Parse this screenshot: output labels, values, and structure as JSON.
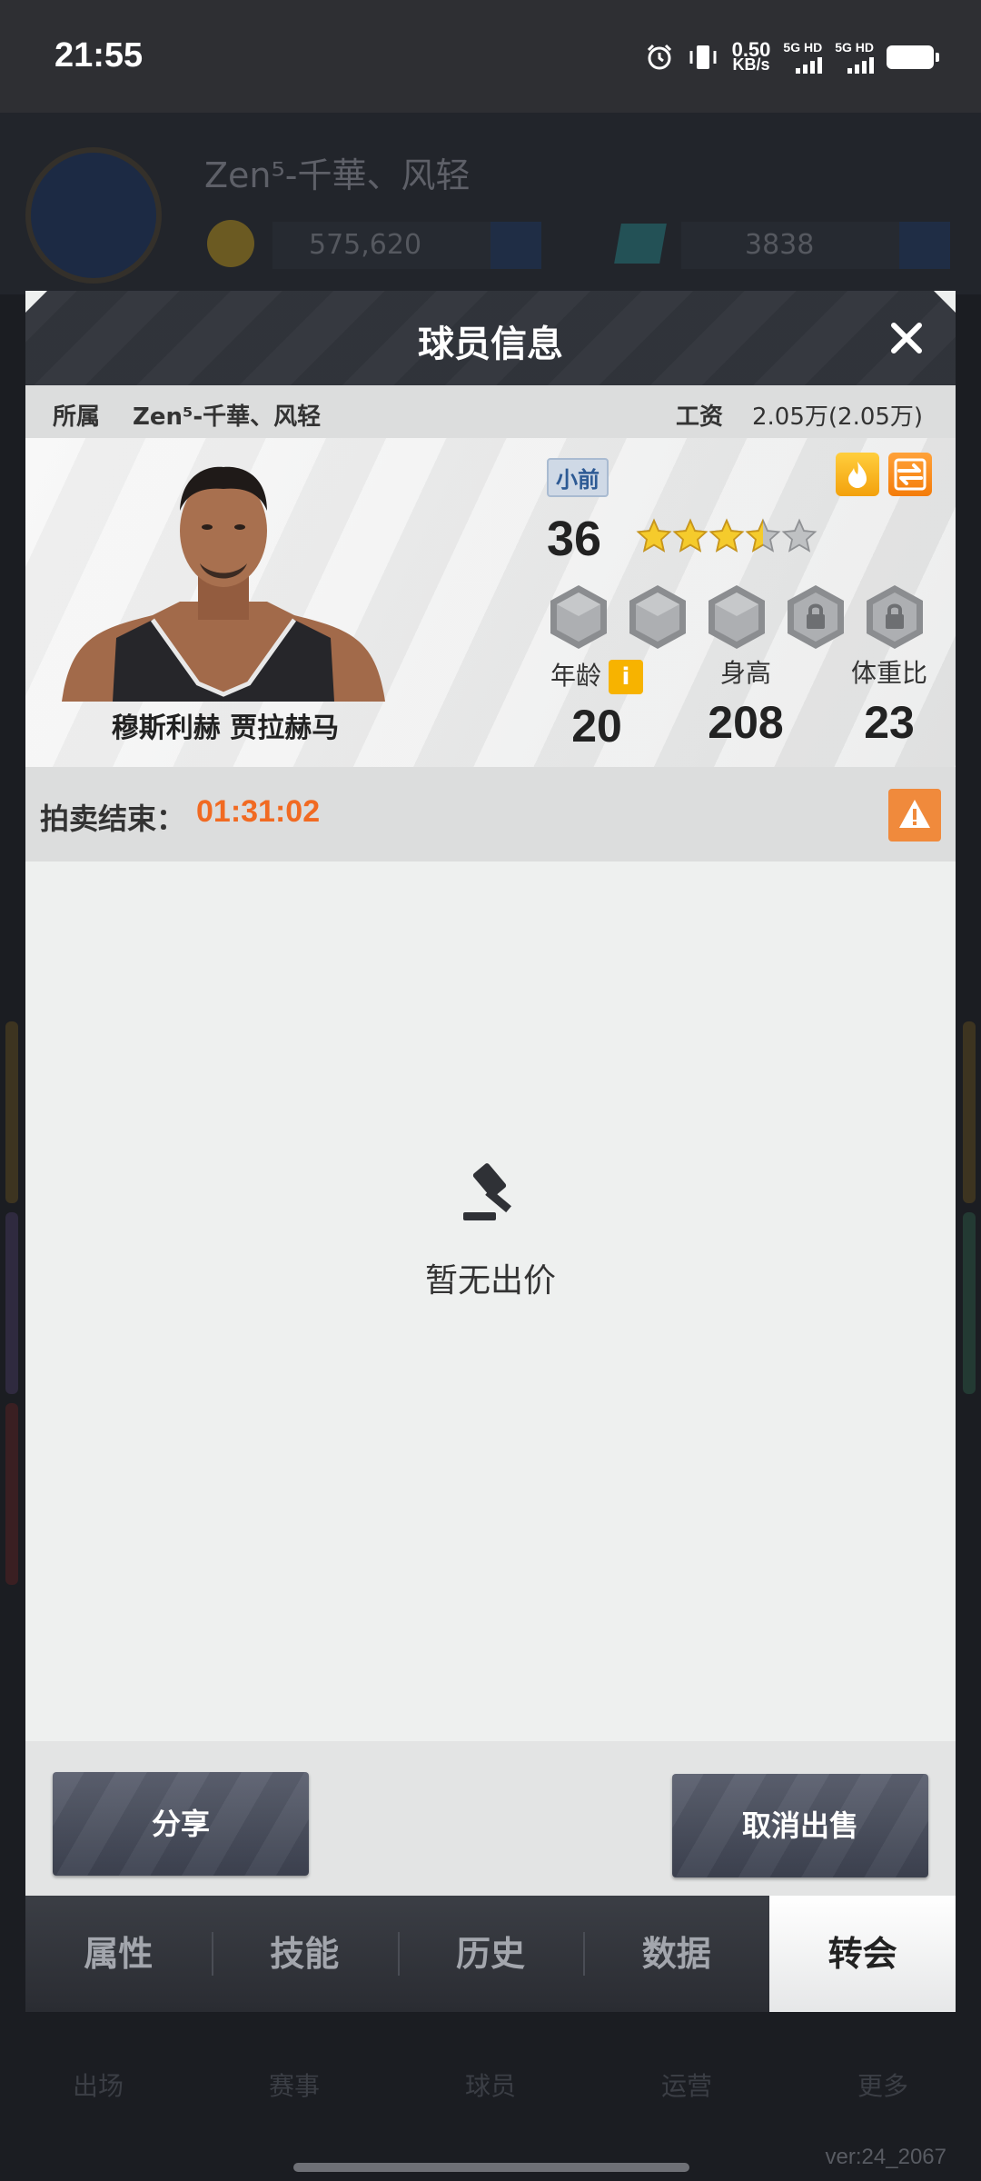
{
  "status_bar": {
    "time": "21:55",
    "net_speed_value": "0.50",
    "net_speed_unit": "KB/s",
    "sim1": "5G HD",
    "sim2": "5G HD"
  },
  "background": {
    "team_name": "Zen⁵-千華、风轻",
    "coins": "575,620",
    "gems": "3838",
    "nav": [
      "出场",
      "赛事",
      "球员",
      "运营",
      "更多"
    ],
    "version": "ver:24_2067"
  },
  "dialog": {
    "title": "球员信息",
    "team_label": "所属",
    "team_value": "Zen⁵-千華、风轻",
    "salary_label": "工资",
    "salary_value": "2.05万(2.05万)",
    "player_name": "穆斯利赫 贾拉赫马",
    "position": "小前",
    "rating": "36",
    "stars_filled": 3.5,
    "stars_total": 5,
    "stats": {
      "age_label": "年龄",
      "age_value": "20",
      "height_label": "身高",
      "height_value": "208",
      "weight_label": "体重比",
      "weight_value": "23"
    },
    "auction_label": "拍卖结束：",
    "auction_time": "01:31:02",
    "empty_text": "暂无出价",
    "share_button": "分享",
    "cancel_sale_button": "取消出售",
    "tabs": [
      "属性",
      "技能",
      "历史",
      "数据",
      "转会"
    ],
    "active_tab_index": 4
  },
  "colors": {
    "accent_orange": "#f16a22",
    "header_dark": "#32353c",
    "gold": "#f7b300"
  }
}
